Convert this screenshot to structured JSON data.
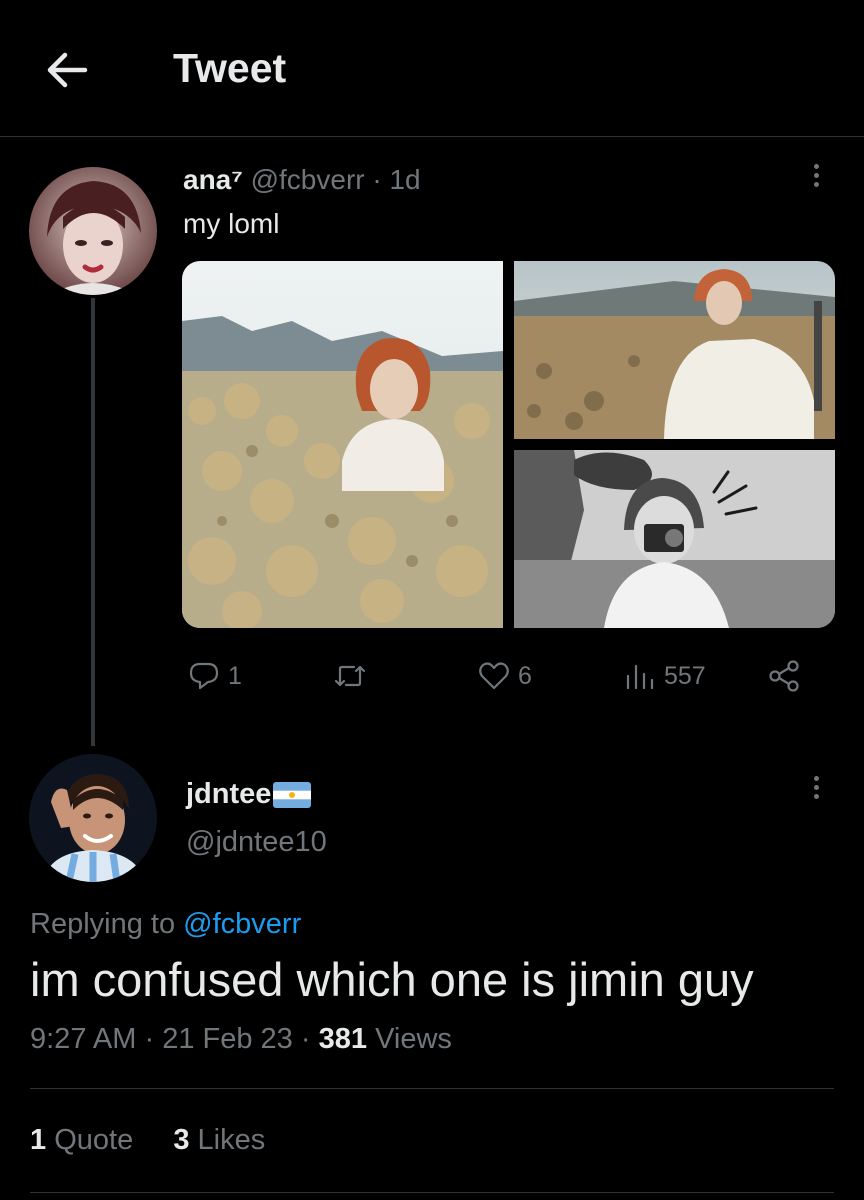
{
  "header": {
    "title": "Tweet"
  },
  "parent_tweet": {
    "display_name": "ana⁷",
    "handle": "@fcbverr",
    "separator": "·",
    "time_ago": "1d",
    "text": "my loml",
    "actions": {
      "replies": "1",
      "retweets": "",
      "likes": "6",
      "views": "557"
    }
  },
  "reply_tweet": {
    "display_name": "jdntee",
    "handle": "@jdntee10",
    "replying_prefix": "Replying to",
    "replying_to": "@fcbverr",
    "text": "im confused which one is jimin guy",
    "time": "9:27 AM",
    "date": "21 Feb 23",
    "separator": "·",
    "views_count": "381",
    "views_label": "Views"
  },
  "engagement": {
    "quotes_count": "1",
    "quotes_label": "Quote",
    "likes_count": "3",
    "likes_label": "Likes"
  },
  "colors": {
    "background": "#000000",
    "text": "#e7e9ea",
    "muted": "#71767b",
    "link": "#1d9bf0",
    "divider": "#2f3336"
  }
}
